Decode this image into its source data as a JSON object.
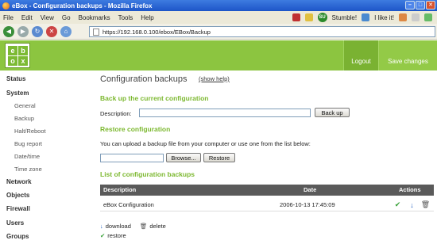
{
  "browser": {
    "title": "eBox - Configuration backups - Mozilla Firefox",
    "menu": [
      "File",
      "Edit",
      "View",
      "Go",
      "Bookmarks",
      "Tools",
      "Help"
    ],
    "stumble_label": "Stumble!",
    "like_label": "I like it!",
    "url": "https://192.168.0.100/ebox/EBox/Backup"
  },
  "header": {
    "logo_letters": [
      "e",
      "b",
      "o",
      "x"
    ],
    "logout": "Logout",
    "save_changes": "Save changes"
  },
  "sidebar": {
    "status": "Status",
    "system": "System",
    "system_items": [
      "General",
      "Backup",
      "Halt/Reboot",
      "Bug report",
      "Date/time",
      "Time zone"
    ],
    "network": "Network",
    "objects": "Objects",
    "firewall": "Firewall",
    "users": "Users",
    "groups": "Groups"
  },
  "main": {
    "title": "Configuration backups",
    "help_link": "(show help)",
    "backup_section": "Back up the current configuration",
    "description_label": "Description:",
    "description_value": "",
    "backup_button": "Back up",
    "restore_section": "Restore configuration",
    "restore_text": "You can upload a backup file from your computer or use one from the list below:",
    "file_value": "",
    "browse_button": "Browse...",
    "restore_button": "Restore",
    "list_section": "List of configuration backups",
    "columns": [
      "Description",
      "Date",
      "Actions"
    ],
    "rows": [
      {
        "description": "eBox Configuration",
        "date": "2006-10-13 17:45:09"
      }
    ],
    "legend": {
      "download": "download",
      "delete": "delete",
      "restore": "restore"
    }
  },
  "colors": {
    "brand_green": "#8cc540",
    "section_green": "#7cb82f",
    "table_header": "#5a5a5a"
  }
}
